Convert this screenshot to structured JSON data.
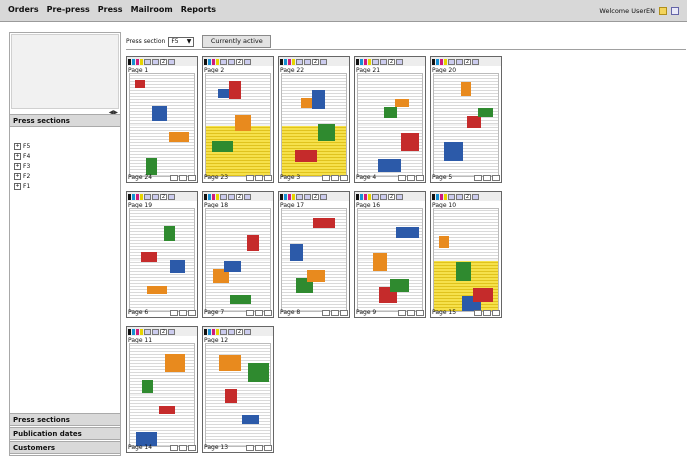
{
  "menu": [
    "Orders",
    "Pre-press",
    "Press",
    "Mailroom",
    "Reports"
  ],
  "welcome": "Welcome UserEN",
  "left": {
    "section_press": "Press sections",
    "section_pub": "Publication dates",
    "section_customers": "Customers",
    "collapse": "◀▶",
    "tree": [
      "F5",
      "F4",
      "F3",
      "F2",
      "F1"
    ]
  },
  "controls": {
    "press_section_label": "Press section",
    "press_section_value": "F5",
    "currently_active": "Currently active"
  },
  "cards": [
    {
      "top": "Page 1",
      "bottom": "Page 24",
      "count": "2"
    },
    {
      "top": "Page 2",
      "bottom": "Page 23",
      "count": "2"
    },
    {
      "top": "Page 22",
      "bottom": "Page 3",
      "count": "2"
    },
    {
      "top": "Page 21",
      "bottom": "Page 4",
      "count": "2"
    },
    {
      "top": "Page 20",
      "bottom": "Page 5",
      "count": "2"
    },
    {
      "top": "Page 19",
      "bottom": "Page 6",
      "count": "2"
    },
    {
      "top": "Page 18",
      "bottom": "Page 7",
      "count": "2"
    },
    {
      "top": "Page 17",
      "bottom": "Page 8",
      "count": "2"
    },
    {
      "top": "Page 16",
      "bottom": "Page 9",
      "count": "2"
    },
    {
      "top": "Page 10",
      "bottom": "Page 15",
      "count": "2"
    },
    {
      "top": "Page 11",
      "bottom": "Page 14",
      "count": "2"
    },
    {
      "top": "Page 12",
      "bottom": "Page 13",
      "count": "2"
    }
  ]
}
